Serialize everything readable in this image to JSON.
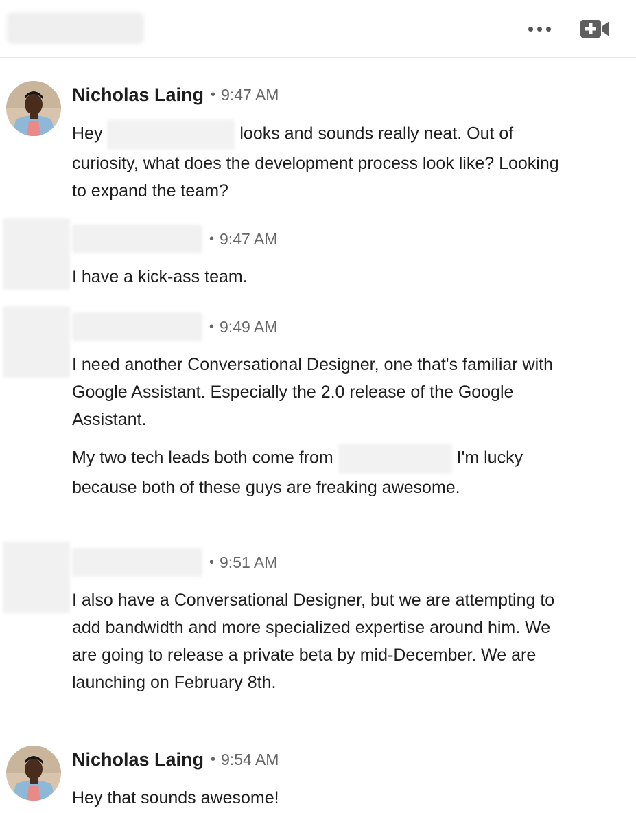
{
  "header": {
    "more_icon": "ellipsis-icon",
    "video_icon": "video-plus-icon"
  },
  "messages": [
    {
      "sender": "Nicholas Laing",
      "separator": "•",
      "time": "9:47 AM",
      "text_before": "Hey",
      "text_after": "looks and sounds really neat. Out of curiosity, what does the development process look like? Looking to expand the team?"
    },
    {
      "sender": "",
      "separator": "•",
      "time": "9:47 AM",
      "text": "I have a kick-ass team."
    },
    {
      "sender": "",
      "separator": "•",
      "time": "9:49 AM",
      "text": "I need another Conversational Designer, one that's familiar with Google Assistant. Especially the 2.0 release of the Google Assistant.",
      "text2_before": "My two tech leads both come from",
      "text2_after": "I'm lucky because both of these guys are freaking awesome."
    },
    {
      "sender": "",
      "separator": "•",
      "time": "9:51 AM",
      "text": "I also have a Conversational Designer, but we are attempting to add bandwidth and more specialized expertise around him. We are going to release a private beta by mid-December. We are launching on February 8th."
    },
    {
      "sender": "Nicholas Laing",
      "separator": "•",
      "time": "9:54 AM",
      "text": "Hey that sounds awesome!"
    }
  ]
}
